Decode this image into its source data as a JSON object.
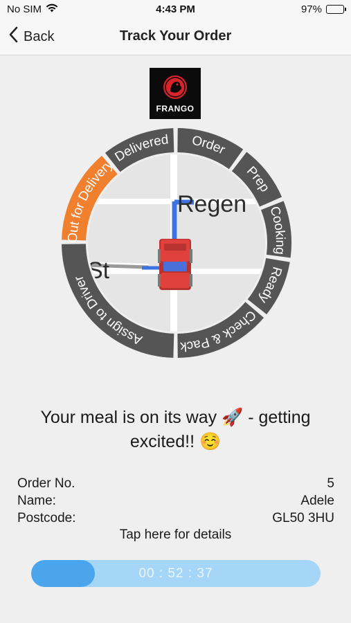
{
  "status_bar": {
    "carrier": "No SIM",
    "time": "4:43 PM",
    "battery": "97%",
    "battery_level": 0.97
  },
  "nav": {
    "back_label": "Back",
    "title": "Track Your Order"
  },
  "brand": {
    "logo_text": "FRANGO"
  },
  "tracker": {
    "map_labels": {
      "street_1": "Regen",
      "street_2": "St"
    },
    "stages": [
      {
        "label": "Order",
        "active": false
      },
      {
        "label": "Prep",
        "active": false
      },
      {
        "label": "Cooking",
        "active": false
      },
      {
        "label": "Ready",
        "active": false
      },
      {
        "label": "Check & Pack",
        "active": false
      },
      {
        "label": "Assign to Driver",
        "active": false
      },
      {
        "label": "Out for Delivery",
        "active": true
      },
      {
        "label": "Delivered",
        "active": false
      }
    ],
    "active_color": "#f07f2e",
    "inactive_color": "#555555"
  },
  "message": "Your meal is on its way 🚀 - getting excited!! ☺️",
  "order": {
    "number_label": "Order No.",
    "number": "5",
    "name_label": "Name:",
    "name": "Adele",
    "postcode_label": "Postcode:",
    "postcode": "GL50 3HU",
    "details_link": "Tap here for details"
  },
  "timer": {
    "value": "00 : 52 : 37",
    "progress": 0.22
  }
}
